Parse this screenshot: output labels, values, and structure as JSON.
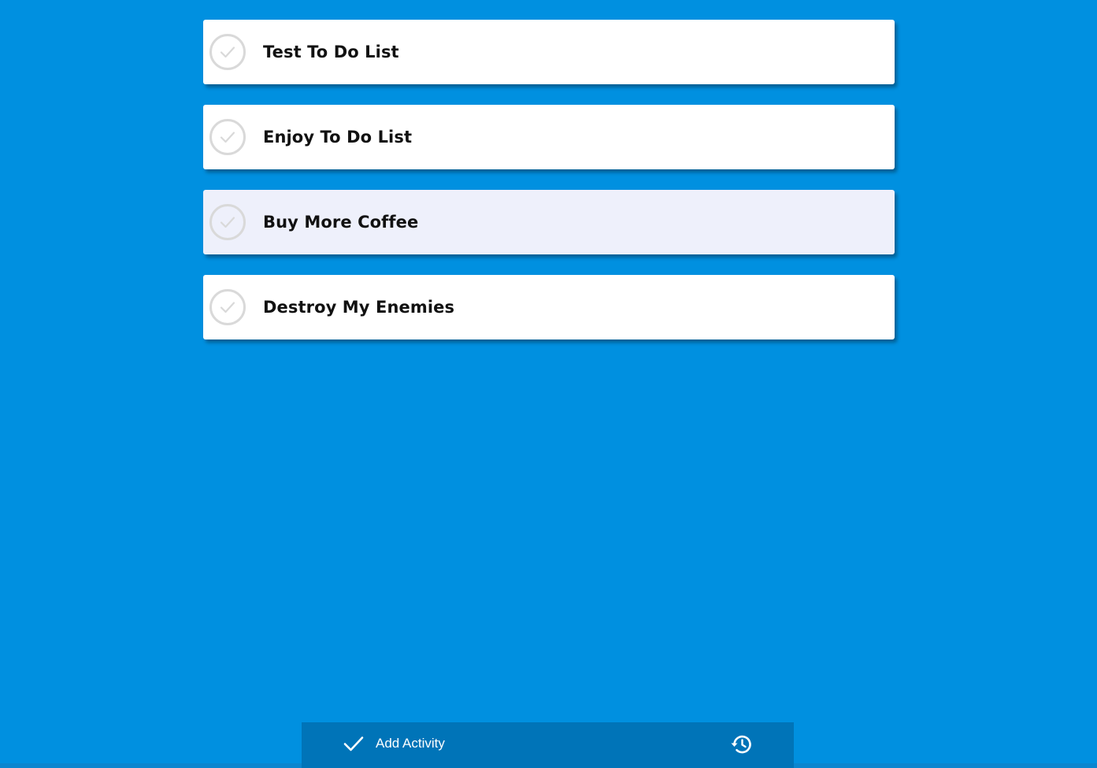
{
  "todos": [
    {
      "label": "Test To Do List",
      "hovered": false
    },
    {
      "label": "Enjoy To Do List",
      "hovered": false
    },
    {
      "label": "Buy More Coffee",
      "hovered": true
    },
    {
      "label": "Destroy My Enemies",
      "hovered": false
    }
  ],
  "toolbar": {
    "add_activity_label": "Add Activity",
    "add_icon": "checkmark-icon",
    "history_icon": "history-icon"
  },
  "colors": {
    "background": "#0090e0",
    "card": "#ffffff",
    "card_hover": "#eef0fb",
    "toolbar": "#0074b8",
    "check_circle": "#d9d9d9"
  }
}
